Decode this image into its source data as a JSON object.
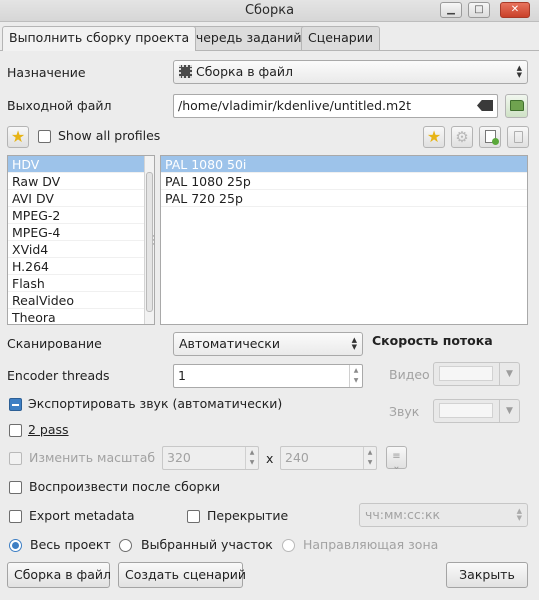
{
  "window": {
    "title": "Сборка",
    "minimize_glyph": "▁",
    "maximize_glyph": "□",
    "close_glyph": "✕"
  },
  "tabs": [
    {
      "label": "Выполнить сборку проекта",
      "active": true
    },
    {
      "label": "Очередь заданий",
      "active": false
    },
    {
      "label": "Сценарии",
      "active": false
    }
  ],
  "destination": {
    "label": "Назначение",
    "value": "Сборка в файл",
    "icon": "film-icon"
  },
  "output": {
    "label": "Выходной файл",
    "value": "/home/vladimir/kdenlive/untitled.m2t",
    "clear_icon": "clear-text-icon",
    "open_icon": "open-folder-icon"
  },
  "profiles": {
    "show_all_label": "Show all profiles",
    "show_all_checked": false,
    "favorite_icon": "star-icon",
    "toolbar_icons": [
      "star-icon",
      "gear-icon",
      "new-profile-icon",
      "delete-icon"
    ]
  },
  "categories": {
    "items": [
      "HDV",
      "Raw DV",
      "AVI DV",
      "MPEG-2",
      "MPEG-4",
      "XVid4",
      "H.264",
      "Flash",
      "RealVideo",
      "Theora"
    ],
    "selected": "HDV"
  },
  "formats": {
    "items": [
      "PAL 1080 50i",
      "PAL 1080 25p",
      "PAL 720 25p"
    ],
    "selected": "PAL 1080 50i"
  },
  "scanning": {
    "label": "Сканирование",
    "value": "Автоматически"
  },
  "bitrate": {
    "heading": "Скорость потока",
    "video_label": "Видео",
    "audio_label": "Звук"
  },
  "encoder_threads": {
    "label": "Encoder threads",
    "value": "1"
  },
  "options": {
    "export_audio": {
      "label": "Экспортировать звук (автоматически)",
      "state": "partial"
    },
    "two_pass": {
      "label": "2 pass",
      "checked": false
    },
    "rescale": {
      "label": "Изменить масштаб",
      "checked": false,
      "enabled": false,
      "width": "320",
      "height": "240",
      "separator": "x"
    },
    "play_after": {
      "label": "Воспроизвести после сборки",
      "checked": false
    },
    "export_metadata": {
      "label": "Export metadata",
      "checked": false
    },
    "overlay": {
      "label": "Перекрытие",
      "checked": false,
      "timecode_placeholder": "чч:мм:сс:кк"
    }
  },
  "range": {
    "options": [
      {
        "label": "Весь проект",
        "checked": true,
        "enabled": true
      },
      {
        "label": "Выбранный участок",
        "checked": false,
        "enabled": true
      },
      {
        "label": "Направляющая зона",
        "checked": false,
        "enabled": false
      }
    ]
  },
  "buttons": {
    "render_label": "Сборка в файл",
    "script_label": "Создать сценарий",
    "close_label": "Закрыть"
  },
  "colors": {
    "selection": "#9dc3ea",
    "accent": "#3e7fc4",
    "window_bg": "#ececec"
  }
}
